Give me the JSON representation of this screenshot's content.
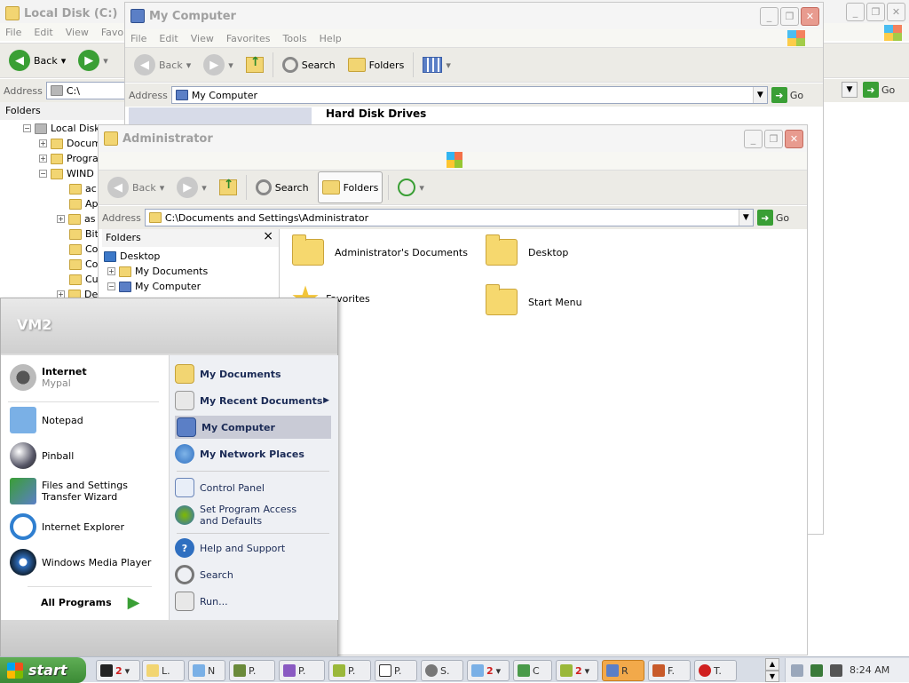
{
  "back_window": {
    "title": "Local Disk (C:)",
    "menu": [
      "File",
      "Edit",
      "View",
      "Favo"
    ],
    "back_label": "Back",
    "address_label": "Address",
    "address_value": "C:\\",
    "go_label": "Go",
    "folders_label": "Folders",
    "tree": [
      {
        "label": "Local Disk",
        "pm": "−"
      },
      {
        "label": "Docum",
        "pm": "+"
      },
      {
        "label": "Progra",
        "pm": "+"
      },
      {
        "label": "WIND",
        "pm": "−"
      },
      {
        "label": "ac",
        "pm": ""
      },
      {
        "label": "Ap",
        "pm": ""
      },
      {
        "label": "as",
        "pm": "+"
      },
      {
        "label": "Bit",
        "pm": ""
      },
      {
        "label": "Co",
        "pm": ""
      },
      {
        "label": "Co",
        "pm": ""
      },
      {
        "label": "Cu",
        "pm": ""
      },
      {
        "label": "De",
        "pm": "+"
      }
    ]
  },
  "mycomputer_window": {
    "title": "My Computer",
    "menu": [
      "File",
      "Edit",
      "View",
      "Favorites",
      "Tools",
      "Help"
    ],
    "toolbar": {
      "back": "Back",
      "search": "Search",
      "folders": "Folders"
    },
    "address_label": "Address",
    "address_value": "My Computer",
    "go_label": "Go",
    "section_header": "Hard Disk Drives"
  },
  "admin_window": {
    "title": "Administrator",
    "toolbar": {
      "back": "Back",
      "search": "Search",
      "folders": "Folders"
    },
    "address_label": "Address",
    "address_value": "C:\\Documents and Settings\\Administrator",
    "go_label": "Go",
    "folders_pane_title": "Folders",
    "folders_close": "×",
    "tree": [
      {
        "label": "Desktop",
        "pm": ""
      },
      {
        "label": "My Documents",
        "pm": "+"
      },
      {
        "label": "My Computer",
        "pm": "−"
      }
    ],
    "items": [
      {
        "label": "Administrator's Documents"
      },
      {
        "label": "Desktop"
      },
      {
        "label": "Favorites"
      },
      {
        "label": "Start Menu"
      }
    ]
  },
  "start_menu": {
    "user": "VM2",
    "pinned": [
      {
        "title": "Internet",
        "sub": "Mypal"
      }
    ],
    "recent": [
      {
        "label": "Notepad"
      },
      {
        "label": "Pinball"
      },
      {
        "label": "Files and Settings Transfer Wizard"
      },
      {
        "label": "Internet Explorer"
      },
      {
        "label": "Windows Media Player"
      }
    ],
    "all_programs": "All Programs",
    "right_bold": [
      {
        "label": "My Documents"
      },
      {
        "label": "My Recent Documents"
      },
      {
        "label": "My Computer"
      },
      {
        "label": "My Network Places"
      }
    ],
    "right_normal": [
      {
        "label": "Control Panel"
      },
      {
        "label": "Set Program Access and Defaults"
      },
      {
        "label": "Help and Support"
      },
      {
        "label": "Search"
      },
      {
        "label": "Run..."
      }
    ]
  },
  "taskbar": {
    "start": "start",
    "buttons": [
      {
        "label": "2",
        "count": true
      },
      {
        "label": "L.",
        "count": false
      },
      {
        "label": "N",
        "count": false
      },
      {
        "label": "P.",
        "count": false
      },
      {
        "label": "P.",
        "count": false
      },
      {
        "label": "P.",
        "count": false
      },
      {
        "label": "P.",
        "count": false
      },
      {
        "label": "S.",
        "count": false
      },
      {
        "label": "2",
        "count": true
      },
      {
        "label": "C",
        "count": false
      },
      {
        "label": "2",
        "count": true
      },
      {
        "label": "R",
        "count": false
      },
      {
        "label": "F.",
        "count": false
      },
      {
        "label": "T.",
        "count": false
      }
    ],
    "clock": "8:24 AM"
  }
}
